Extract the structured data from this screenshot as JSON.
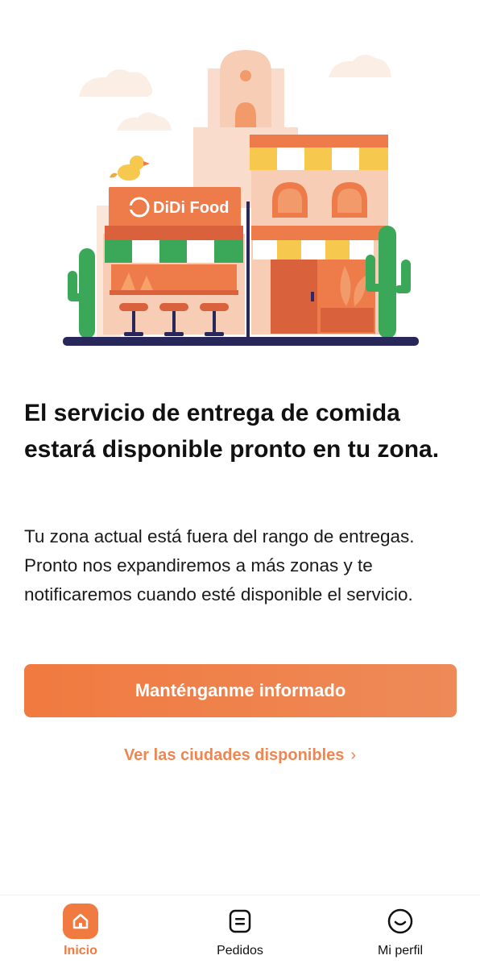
{
  "brand": {
    "logo_text": "DiDi Food",
    "accent": "#f07a40"
  },
  "main": {
    "headline": "El servicio de entrega de comida estará disponible pronto en tu zona.",
    "description": "Tu zona actual está fuera del rango de entregas. Pronto nos expandiremos a más zonas y te notificaremos cuando esté disponible el servicio.",
    "primary_button": "Manténganme informado",
    "cities_link": "Ver las ciudades disponibles"
  },
  "nav": {
    "items": [
      {
        "label": "Inicio",
        "icon": "home-icon",
        "active": true
      },
      {
        "label": "Pedidos",
        "icon": "orders-icon",
        "active": false
      },
      {
        "label": "Mi perfil",
        "icon": "profile-icon",
        "active": false
      }
    ]
  }
}
